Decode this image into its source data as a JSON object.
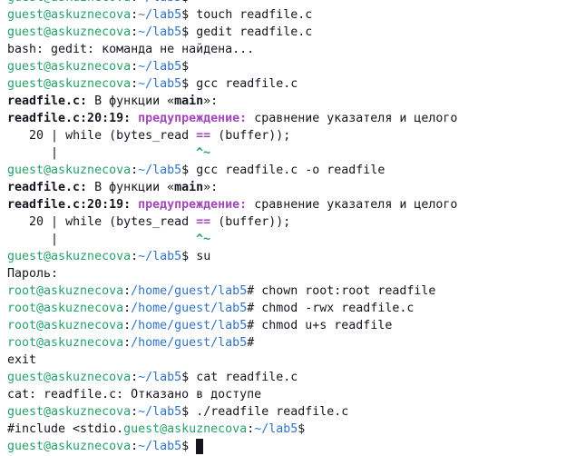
{
  "terminal": {
    "colors": {
      "background": "#ffffff",
      "text": "#171421",
      "user_host": "#26a269",
      "path": "#2f74c8",
      "warning": "#a347ba",
      "caret": "#26a269",
      "cursor": "#171421"
    },
    "lines": [
      {
        "prompt": {
          "user_host": "guest@askuznecova",
          "separator": ":",
          "path": "~/lab5",
          "symbol": "$"
        }
      },
      {
        "prompt": {
          "user_host": "guest@askuznecova",
          "separator": ":",
          "path": "~/lab5",
          "symbol": "$"
        },
        "command": "touch readfile.c"
      },
      {
        "prompt": {
          "user_host": "guest@askuznecova",
          "separator": ":",
          "path": "~/lab5",
          "symbol": "$"
        },
        "command": "gedit readfile.c"
      },
      {
        "output": "bash: gedit: команда не найдена..."
      },
      {
        "prompt": {
          "user_host": "guest@askuznecova",
          "separator": ":",
          "path": "~/lab5",
          "symbol": "$"
        }
      },
      {
        "prompt": {
          "user_host": "guest@askuznecova",
          "separator": ":",
          "path": "~/lab5",
          "symbol": "$"
        },
        "command": "gcc readfile.c"
      },
      {
        "context": {
          "file": "readfile.c:",
          "text_before": " В функции «",
          "function": "main",
          "text_after": "»:"
        }
      },
      {
        "diagnostic": {
          "location": "readfile.c:20:19:",
          "severity": "предупреждение:",
          "message": "сравнение указателя и целого"
        }
      },
      {
        "source": {
          "line_number": "20",
          "gutter": "|",
          "code_before": "while (bytes_read ",
          "highlight": "==",
          "code_after": " (buffer));"
        }
      },
      {
        "marker": {
          "gutter": "|",
          "caret": "^~"
        }
      },
      {
        "prompt": {
          "user_host": "guest@askuznecova",
          "separator": ":",
          "path": "~/lab5",
          "symbol": "$"
        },
        "command": "gcc readfile.c -o readfile"
      },
      {
        "context": {
          "file": "readfile.c:",
          "text_before": " В функции «",
          "function": "main",
          "text_after": "»:"
        }
      },
      {
        "diagnostic": {
          "location": "readfile.c:20:19:",
          "severity": "предупреждение:",
          "message": "сравнение указателя и целого"
        }
      },
      {
        "source": {
          "line_number": "20",
          "gutter": "|",
          "code_before": "while (bytes_read ",
          "highlight": "==",
          "code_after": " (buffer));"
        }
      },
      {
        "marker": {
          "gutter": "|",
          "caret": "^~"
        }
      },
      {
        "prompt": {
          "user_host": "guest@askuznecova",
          "separator": ":",
          "path": "~/lab5",
          "symbol": "$"
        },
        "command": "su"
      },
      {
        "output": "Пароль:"
      },
      {
        "prompt": {
          "user_host": "root@askuznecova",
          "separator": ":",
          "path": "/home/guest/lab5",
          "symbol": "#"
        },
        "command": "chown root:root readfile"
      },
      {
        "prompt": {
          "user_host": "root@askuznecova",
          "separator": ":",
          "path": "/home/guest/lab5",
          "symbol": "#"
        },
        "command": "chmod -rwx readfile.c"
      },
      {
        "prompt": {
          "user_host": "root@askuznecova",
          "separator": ":",
          "path": "/home/guest/lab5",
          "symbol": "#"
        },
        "command": "chmod u+s readfile"
      },
      {
        "prompt": {
          "user_host": "root@askuznecova",
          "separator": ":",
          "path": "/home/guest/lab5",
          "symbol": "#"
        }
      },
      {
        "output": "exit"
      },
      {
        "prompt": {
          "user_host": "guest@askuznecova",
          "separator": ":",
          "path": "~/lab5",
          "symbol": "$"
        },
        "command": "cat readfile.c"
      },
      {
        "output": "cat: readfile.c: Отказано в доступе"
      },
      {
        "prompt": {
          "user_host": "guest@askuznecova",
          "separator": ":",
          "path": "~/lab5",
          "symbol": "$"
        },
        "command": "./readfile readfile.c"
      },
      {
        "output": "#include <stdio.",
        "prompt": {
          "user_host": "guest@askuznecova",
          "separator": ":",
          "path": "~/lab5",
          "symbol": "$"
        }
      },
      {
        "prompt": {
          "user_host": "guest@askuznecova",
          "separator": ":",
          "path": "~/lab5",
          "symbol": "$"
        },
        "cursor": true
      }
    ]
  }
}
